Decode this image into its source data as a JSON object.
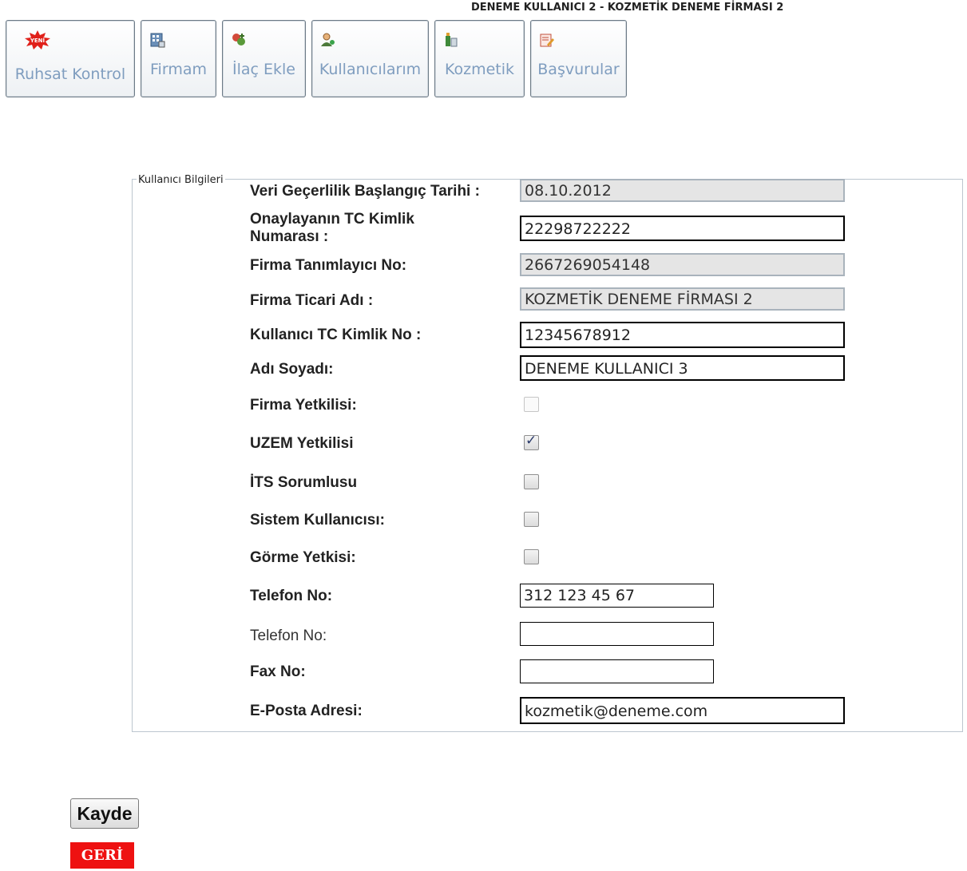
{
  "header": {
    "user_company": "DENEME KULLANICI 2 - KOZMETİK DENEME FİRMASI 2"
  },
  "nav": {
    "items": [
      {
        "label": "Ruhsat Kontrol",
        "icon": "new-badge-icon"
      },
      {
        "label": "Firmam",
        "icon": "company-icon"
      },
      {
        "label": "İlaç Ekle",
        "icon": "medicine-add-icon"
      },
      {
        "label": "Kullanıcılarım",
        "icon": "users-icon"
      },
      {
        "label": "Kozmetik",
        "icon": "cosmetic-icon"
      },
      {
        "label": "Başvurular",
        "icon": "applications-icon"
      }
    ]
  },
  "form": {
    "legend": "Kullanıcı Bilgileri",
    "start_date_label": "Veri Geçerlilik Başlangıç Tarihi :",
    "start_date_value": "08.10.2012",
    "approver_tc_label_line1": "Onaylayanın TC Kimlik",
    "approver_tc_label_line2": "Numarası :",
    "approver_tc_value": "22298722222",
    "company_id_label": "Firma Tanımlayıcı No:",
    "company_id_value": "2667269054148",
    "company_name_label": "Firma Ticari Adı :",
    "company_name_value": "KOZMETİK DENEME FİRMASI 2",
    "user_tc_label": "Kullanıcı TC Kimlik No :",
    "user_tc_value": "12345678912",
    "full_name_label": "Adı Soyadı:",
    "full_name_value": "DENEME KULLANICI 3",
    "company_authority_label": "Firma Yetkilisi:",
    "company_authority_checked": false,
    "uzem_authority_label": "UZEM Yetkilisi",
    "uzem_authority_checked": true,
    "its_responsible_label": "İTS Sorumlusu",
    "its_responsible_checked": false,
    "system_user_label": "Sistem Kullanıcısı:",
    "system_user_checked": false,
    "view_authority_label": "Görme Yetkisi:",
    "view_authority_checked": false,
    "phone_label": "Telefon No:",
    "phone_value": "312 123 45 67",
    "phone2_label": "Telefon No:",
    "phone2_value": "",
    "fax_label": "Fax No:",
    "fax_value": "",
    "email_label": "E-Posta Adresi:",
    "email_value": "kozmetik@deneme.com"
  },
  "actions": {
    "save_label": "Kayde",
    "back_label": "GERİ"
  },
  "colors": {
    "nav_text": "#7f9dbf",
    "back_button": "#ee1111"
  }
}
